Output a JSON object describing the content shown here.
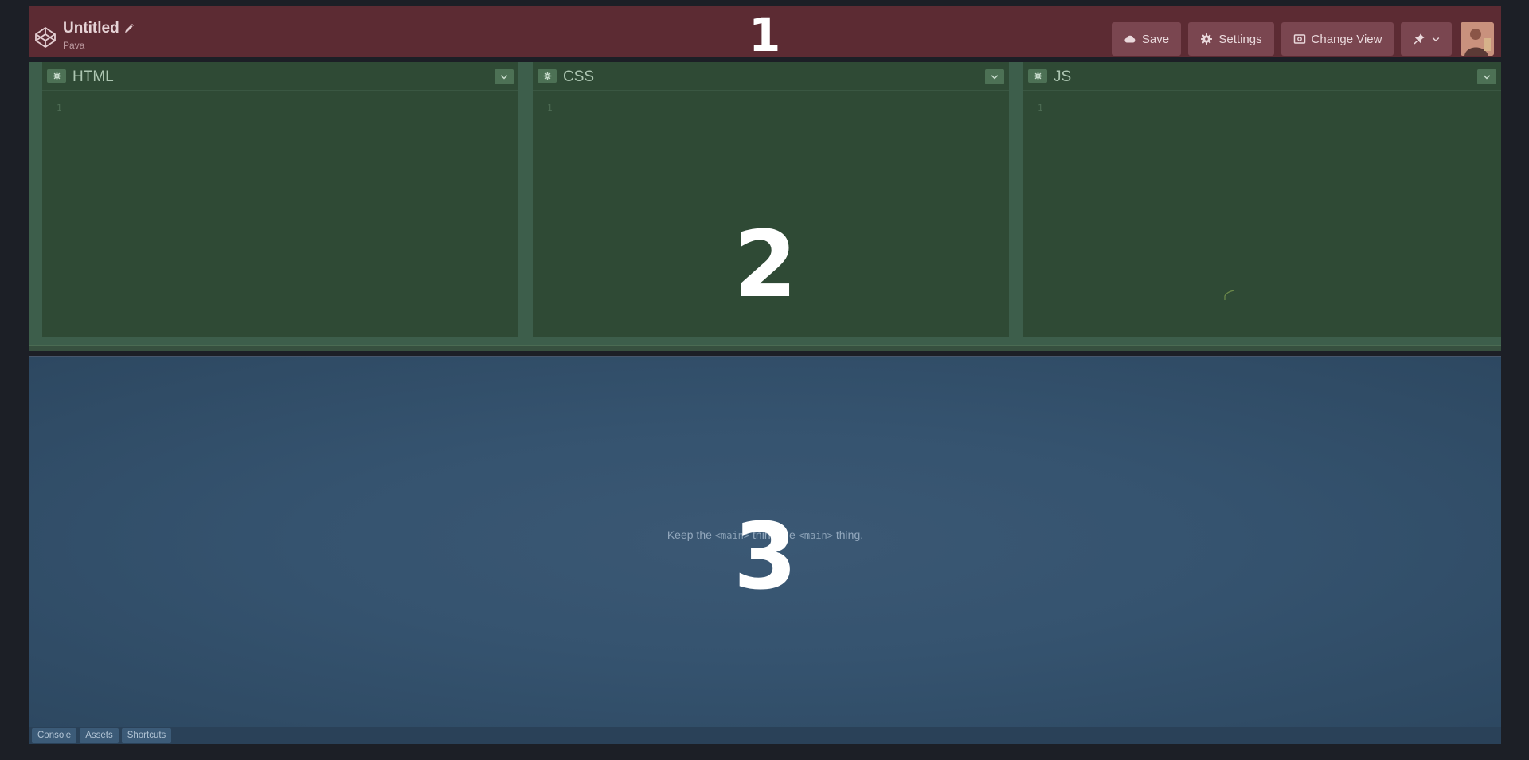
{
  "header": {
    "title": "Untitled",
    "user": "Pava",
    "region_label": "1",
    "buttons": {
      "save": "Save",
      "settings": "Settings",
      "change_view": "Change View"
    },
    "icons": [
      "codepen-logo-icon",
      "pencil-icon",
      "cloud-icon",
      "gear-icon",
      "view-icon",
      "pin-icon",
      "chevron-down-icon"
    ]
  },
  "editors": {
    "region_label": "2",
    "panels": [
      {
        "name": "HTML",
        "line": "1"
      },
      {
        "name": "CSS",
        "line": "1"
      },
      {
        "name": "JS",
        "line": "1"
      }
    ]
  },
  "preview": {
    "region_label": "3",
    "text_before": "Keep the ",
    "code_1": "<main>",
    "text_middle": " thing the ",
    "code_2": "<main>",
    "text_after": " thing."
  },
  "footer": {
    "console": "Console",
    "assets": "Assets",
    "shortcuts": "Shortcuts"
  },
  "colors": {
    "header_bg": "#5c2b33",
    "editor_bg": "#2f4a35",
    "preview_bg": "#35536f",
    "page_bg": "#1c1f26"
  }
}
